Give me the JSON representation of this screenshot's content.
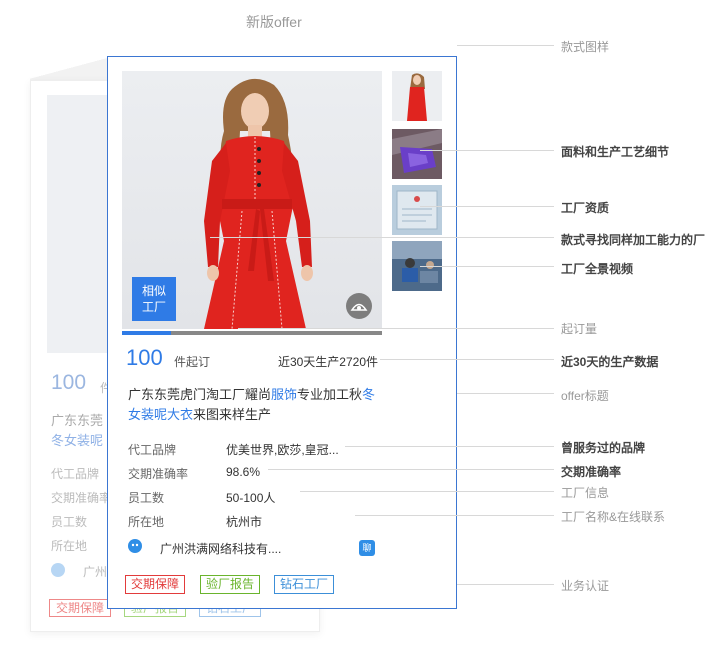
{
  "page": {
    "title": "新版offer"
  },
  "old_card": {
    "qty": "100",
    "qty_unit": "件",
    "title_line1": "广东东莞",
    "title_line2": "冬女装呢",
    "rows": [
      "代工品牌",
      "交期准确率",
      "员工数",
      "所在地"
    ],
    "company": "广州",
    "tags": [
      "交期保障",
      "验厂报告",
      "钻石工厂"
    ]
  },
  "card": {
    "similar_button": {
      "line1": "相似",
      "line2": "工厂"
    },
    "progress_fraction": 0.19,
    "min_order_qty": "100",
    "min_order_unit": "件起订",
    "production_30d": "近30天生产2720件",
    "offer_title": {
      "part1": "广东东莞虎门淘工厂耀尚",
      "highlight1": "服饰",
      "part2": "专业加工秋",
      "highlight2": "冬女装呢大衣",
      "part3": "来图来样生产"
    },
    "info": [
      {
        "label": "代工品牌",
        "value": "优美世界,欧莎,皇冠..."
      },
      {
        "label": "交期准确率",
        "value": "98.6%"
      },
      {
        "label": "员工数",
        "value": "50-100人"
      },
      {
        "label": "所在地",
        "value": "杭州市"
      }
    ],
    "company_name": "广州洪满网络科技有....",
    "chat_icon_text": "聊",
    "tags": [
      {
        "label": "交期保障",
        "color": "#e23b3b"
      },
      {
        "label": "验厂报告",
        "color": "#6ab42d"
      },
      {
        "label": "钻石工厂",
        "color": "#3c8fd8"
      }
    ]
  },
  "annotations": {
    "style_image": "款式图样",
    "fabric_detail": "面料和生产工艺细节",
    "factory_cert": "工厂资质",
    "similar_factory": "款式寻找同样加工能力的厂",
    "factory_video": "工厂全景视频",
    "min_order": "起订量",
    "production_30d": "近30天的生产数据",
    "offer_title": "offer标题",
    "served_brands": "曾服务过的品牌",
    "delivery_accuracy": "交期准确率",
    "factory_info": "工厂信息",
    "factory_contact": "工厂名称&在线联系",
    "business_cert": "业务认证"
  },
  "colors": {
    "accent": "#2f7be6",
    "card_border": "#3b76d2",
    "dress_red": "#e0241f"
  }
}
